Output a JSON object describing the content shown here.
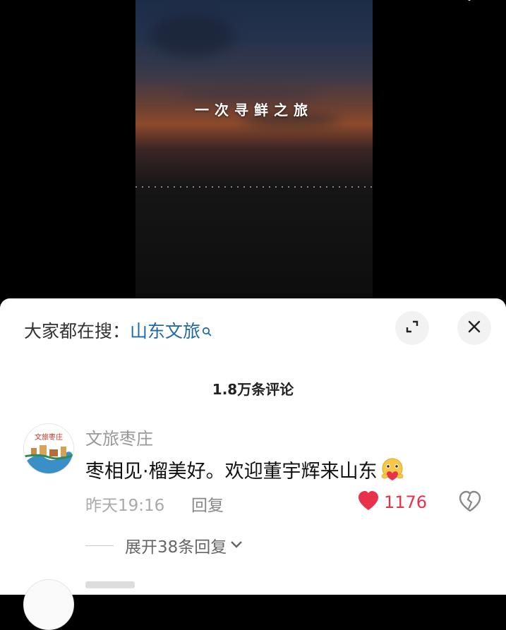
{
  "video": {
    "caption": "一次寻鲜之旅"
  },
  "top_bar": {
    "search_icon": "search-icon"
  },
  "comments_panel": {
    "hot_search_label": "大家都在搜：",
    "hot_search_term": "山东文旅",
    "expand_icon": "expand-icon",
    "close_icon": "close-icon",
    "count_label": "1.8万条评论",
    "comments": [
      {
        "avatar_text": "文旅枣庄",
        "author": "文旅枣庄",
        "text": "枣相见·榴美好。欢迎董宇辉来山东",
        "emoji": "hugging-heart-emoji",
        "time": "昨天19:16",
        "reply_label": "回复",
        "like_count": "1176",
        "liked": true,
        "expand_replies_label": "展开38条回复"
      }
    ]
  },
  "colors": {
    "accent_blue": "#1f6aa6",
    "like_red": "#e8324b",
    "muted": "#999999"
  }
}
